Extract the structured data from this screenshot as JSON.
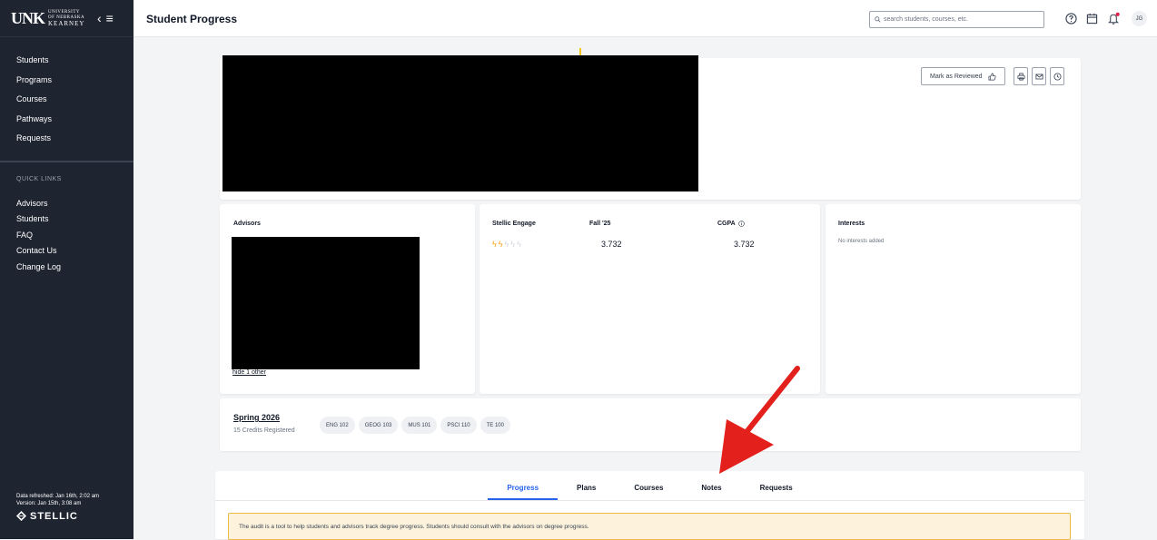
{
  "sidebar": {
    "logo_mark": "UNK",
    "logo_top": "UNIVERSITY",
    "logo_mid": "OF NEBRASKA",
    "logo_bottom": "KEARNEY",
    "nav": [
      "Students",
      "Programs",
      "Courses",
      "Pathways",
      "Requests"
    ],
    "quick_links_title": "QUICK LINKS",
    "quick_links": [
      "Advisors",
      "Students",
      "FAQ",
      "Contact Us",
      "Change Log"
    ],
    "data_refreshed": "Data refreshed: Jan 16th, 2:02 am",
    "version": "Version: Jan 15th, 3:08 am",
    "brand": "STELLIC"
  },
  "header": {
    "title": "Student Progress",
    "search_placeholder": "search students, courses, etc.",
    "avatar_initials": "JG"
  },
  "profile": {
    "mark_reviewed": "Mark as Reviewed"
  },
  "advisors": {
    "title": "Advisors",
    "hide_link": "hide 1 other"
  },
  "stats": {
    "engage_label": "Stellic Engage",
    "engage_rating": 2,
    "engage_max": 5,
    "term_label": "Fall '25",
    "term_gpa": "3.732",
    "cgpa_label": "CGPA",
    "cgpa": "3.732"
  },
  "interests": {
    "title": "Interests",
    "empty": "No interests added"
  },
  "term_card": {
    "term": "Spring 2026",
    "credits": "15 Credits Registered",
    "courses": [
      "ENG 102",
      "GEOG 103",
      "MUS 101",
      "PSCI 110",
      "TE 100"
    ]
  },
  "tabs": [
    "Progress",
    "Plans",
    "Courses",
    "Notes",
    "Requests"
  ],
  "notice": "The audit is a tool to help students and advisors track degree progress. Students should consult with the advisors on degree progress.",
  "colors": {
    "sidebar_bg": "#1e2430",
    "accent": "#2563eb",
    "engage_star": "#f59e0b",
    "arrow": "#e3201b",
    "notification_dot": "#e11d48"
  }
}
